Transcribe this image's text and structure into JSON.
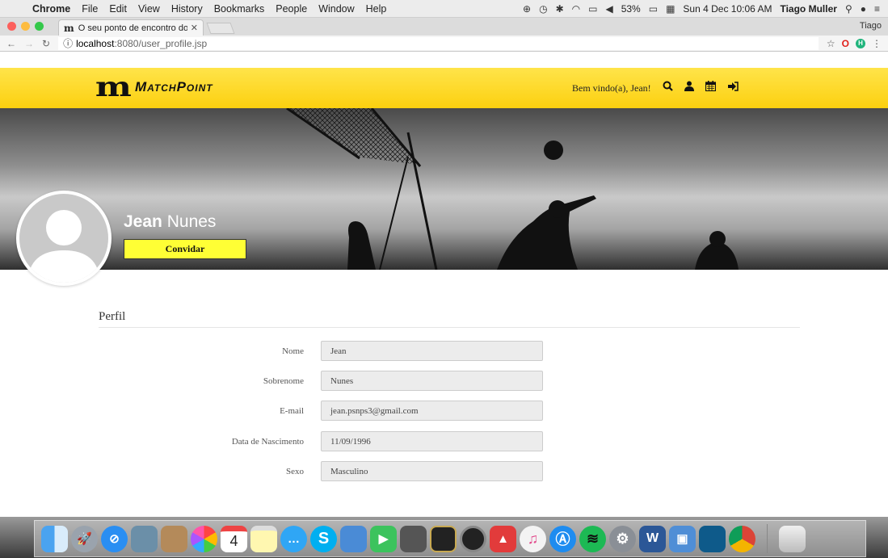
{
  "menubar": {
    "app": "Chrome",
    "items": [
      "File",
      "Edit",
      "View",
      "History",
      "Bookmarks",
      "People",
      "Window",
      "Help"
    ],
    "battery": "53%",
    "clock": "Sun 4 Dec  10:06 AM",
    "user": "Tiago Muller"
  },
  "browser": {
    "tab_title": "O seu ponto de encontro dos e",
    "profile_name": "Tiago",
    "url_scheme_icon": "ⓘ",
    "url_host": "localhost",
    "url_path": ":8080/user_profile.jsp"
  },
  "header": {
    "logo_mark": "m",
    "logo_word": "MatchPoint",
    "welcome": "Bem vindo(a), Jean!"
  },
  "profile": {
    "first_name": "Jean",
    "last_name": "Nunes",
    "invite_label": "Convidar"
  },
  "form": {
    "section_title": "Perfil",
    "fields": [
      {
        "label": "Nome",
        "value": "Jean"
      },
      {
        "label": "Sobrenome",
        "value": "Nunes"
      },
      {
        "label": "E-mail",
        "value": "jean.psnps3@gmail.com"
      },
      {
        "label": "Data de Nascimento",
        "value": "11/09/1996"
      },
      {
        "label": "Sexo",
        "value": "Masculino"
      }
    ]
  },
  "dock": {
    "calendar_day": "4",
    "apps": [
      "finder",
      "launchpad",
      "safari",
      "preview",
      "contacts",
      "photos",
      "calendar",
      "notes",
      "messages",
      "skype",
      "keynote",
      "facetime",
      "photo-booth",
      "garageband",
      "dvd-player",
      "popcorn-time",
      "itunes",
      "app-store",
      "spotify",
      "system-preferences",
      "word",
      "virtualbox",
      "mysql-workbench",
      "chrome",
      "trash"
    ]
  },
  "colors": {
    "header_yellow": "#fcd00f",
    "button_yellow": "#ffff35"
  }
}
